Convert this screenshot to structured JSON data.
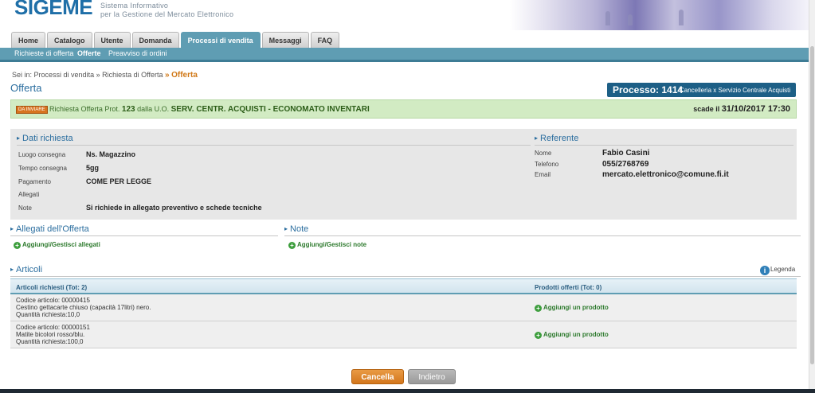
{
  "header": {
    "logo": "SIGEME",
    "logo_line1": "Sistema Informativo",
    "logo_line2": "per la Gestione del Mercato Elettronico"
  },
  "tabs": [
    "Home",
    "Catalogo",
    "Utente",
    "Domanda",
    "Processi di vendita",
    "Messaggi",
    "FAQ"
  ],
  "active_tab": "Processi di vendita",
  "subnav": [
    "Richieste di offerta",
    "Offerte",
    "Preavviso di ordini"
  ],
  "breadcrumb": {
    "prefix": "Sei in:",
    "item1": "Processi di vendita",
    "sep": "»",
    "item2": "Richiesta di Offerta",
    "current": "Offerta"
  },
  "page_title": "Offerta",
  "process": {
    "label": "Processo: 1414",
    "description": "Cancelleria x Servizio Centrale Acquisti"
  },
  "status": {
    "badge": "DA INVIARE",
    "text_prefix": "Richiesta Offerta Prot.",
    "prot": "123",
    "text_mid": "dalla U.O.",
    "unit": "SERV. CENTR. ACQUISTI - ECONOMATO INVENTARI",
    "deadline_prefix": "scade il",
    "deadline": "31/10/2017 17:30"
  },
  "dati_richiesta": {
    "title": "Dati richiesta",
    "fields": [
      {
        "label": "Luogo consegna",
        "value": "Ns. Magazzino"
      },
      {
        "label": "Tempo consegna",
        "value": "5gg"
      },
      {
        "label": "Pagamento",
        "value": "COME PER LEGGE"
      },
      {
        "label": "Allegati",
        "value": ""
      },
      {
        "label": "Note",
        "value": "Si richiede in allegato preventivo e schede tecniche"
      }
    ]
  },
  "referente": {
    "title": "Referente",
    "fields": [
      {
        "label": "Nome",
        "value": "Fabio Casini"
      },
      {
        "label": "Telefono",
        "value": "055/2768769"
      },
      {
        "label": "Email",
        "value": "mercato.elettronico@comune.fi.it"
      }
    ]
  },
  "allegati": {
    "title": "Allegati dell'Offerta",
    "action": "Aggiungi/Gestisci allegati"
  },
  "note": {
    "title": "Note",
    "action": "Aggiungi/Gestisci note"
  },
  "articoli": {
    "title": "Articoli",
    "legenda": "Legenda",
    "col_richiesti": "Articoli richiesti (Tot: 2)",
    "col_offerti": "Prodotti offerti (Tot: 0)",
    "rows": [
      {
        "code": "Codice articolo: 00000415",
        "desc": "Cestino gettacarte chiuso (capacità 17litri) nero.",
        "qty": "Quantità richiesta:10,0",
        "action": "Aggiungi un prodotto"
      },
      {
        "code": "Codice articolo: 00000151",
        "desc": "Matite bicolori rosso/blu.",
        "qty": "Quantità richiesta:100,0",
        "action": "Aggiungi un prodotto"
      }
    ]
  },
  "buttons": {
    "cancel": "Cancella",
    "back": "Indietro"
  }
}
